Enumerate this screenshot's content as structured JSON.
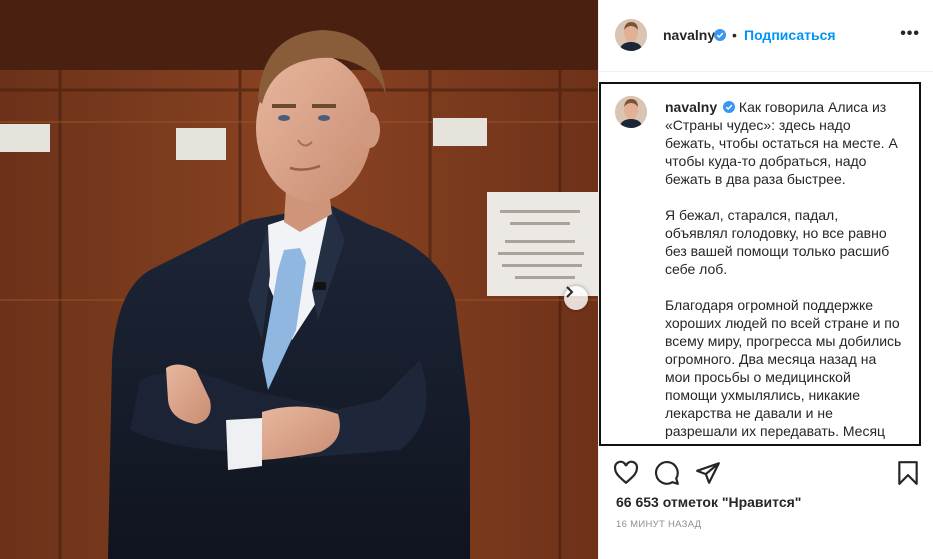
{
  "post": {
    "photo": {
      "alt_subject": "man-in-suit-arms-crossed"
    }
  },
  "header": {
    "username": "navalny",
    "separator": "•",
    "follow_label": "Подписаться",
    "more_label": "•••"
  },
  "caption": {
    "username": "navalny",
    "paragraphs": [
      "Как говорила Алиса из «Страны чудес»: здесь надо бежать, чтобы остаться на месте. А чтобы куда-то добраться, надо бежать в два раза быстрее.",
      "Я бежал, старался, падал, объявлял голодовку, но все равно без вашей помощи только расшиб себе лоб.",
      "Благодаря огромной поддержке хороших людей по всей стране и по всему миру, прогресса мы добились огромного. Два месяца назад на мои просьбы о медицинской помощи ухмылялись, никакие лекарства не давали и не разрешали их передавать. Месяц назад мне смеялись в лицо на фразы типа: “А"
    ]
  },
  "actions": {
    "icons": [
      "heart-icon",
      "comment-icon",
      "share-icon",
      "bookmark-icon"
    ]
  },
  "stats": {
    "likes_text": "66 653 отметок \"Нравится\"",
    "time_text": "16 МИНУТ НАЗАД"
  },
  "colors": {
    "follow": "#0095f6",
    "verified": "#3897f0",
    "text": "#262626",
    "muted": "#8e8e8e"
  }
}
